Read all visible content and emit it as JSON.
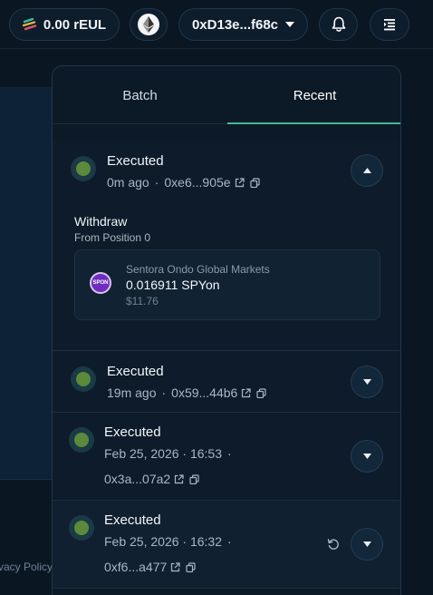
{
  "header": {
    "balance": "0.00 rEUL",
    "network_icon": "ethereum-icon",
    "address": "0xD13e...f68c",
    "notifications_icon": "bell-icon",
    "menu_icon": "menu-icon"
  },
  "background": {
    "footer_link": "Privacy Policy"
  },
  "tabs": [
    {
      "label": "Batch",
      "active": false
    },
    {
      "label": "Recent",
      "active": true
    }
  ],
  "transactions": [
    {
      "status": "Executed",
      "time": "0m ago",
      "hash": "0xe6...905e",
      "expanded": true,
      "action": "Withdraw",
      "action_sub": "From Position 0",
      "asset": {
        "icon_text": "SPON",
        "name": "Sentora Ondo Global Markets",
        "amount": "0.016911 SPYon",
        "usd": "$11.76"
      }
    },
    {
      "status": "Executed",
      "time": "19m ago",
      "hash": "0x59...44b6",
      "expanded": false
    },
    {
      "status": "Executed",
      "time": "Feb 25, 2026 · 16:53",
      "hash": "0x3a...07a2",
      "expanded": false
    },
    {
      "status": "Executed",
      "time": "Feb 25, 2026 · 16:32",
      "hash": "0xf6...a477",
      "expanded": false,
      "retry": true
    }
  ],
  "colors": {
    "accent": "#43b894",
    "status_dot": "#5c8a3c",
    "background": "#0a1622"
  }
}
